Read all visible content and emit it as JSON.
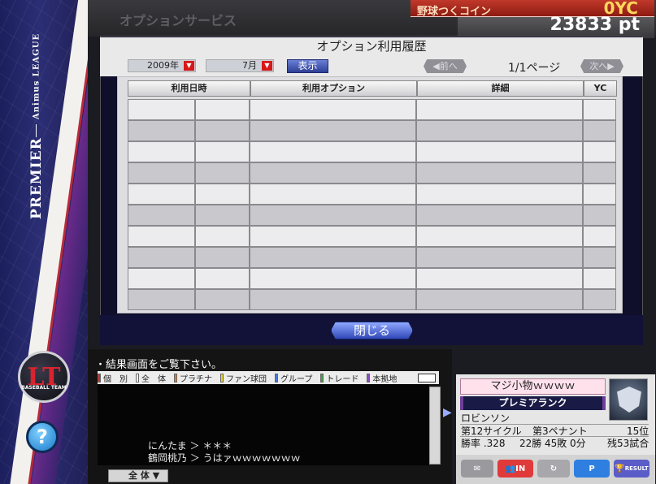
{
  "top": {
    "service_title": "オプションサービス",
    "coin_label": "野球つくコイン",
    "coin_value": "0YC",
    "points": "23833 pt"
  },
  "sidebar": {
    "league": "PREMIER",
    "league_sub": "Animus LEAGUE",
    "team_logo_text": "LT",
    "team_logo_sub": "BASEBALL TEAM",
    "help_icon": "question-icon"
  },
  "panel": {
    "title": "オプション利用履歴",
    "year": "2009年",
    "month": "7月",
    "show_button": "表示",
    "prev_button": "前へ",
    "next_button": "次へ",
    "page_indicator": "1/1ページ",
    "columns": [
      "利用日時",
      "利用オプション",
      "詳細",
      "YC"
    ],
    "row_count": 10,
    "close_button": "閉じる"
  },
  "chat": {
    "notice": "・結果画面をご覧下さい。",
    "tabs": [
      {
        "label": "個　別",
        "color": "#d42a2a"
      },
      {
        "label": "全　体",
        "color": "#ffffff"
      },
      {
        "label": "プラチナ",
        "color": "#f07a1c"
      },
      {
        "label": "ファン球団",
        "color": "#e8d023"
      },
      {
        "label": "グループ",
        "color": "#4a7ad8"
      },
      {
        "label": "トレード",
        "color": "#3fa24a"
      },
      {
        "label": "本拠地",
        "color": "#8a4fc4"
      }
    ],
    "lines": [
      {
        "speaker": "にんたま",
        "text": "＊＊＊"
      },
      {
        "speaker": "鶴岡桃乃",
        "text": "うはァｗｗｗｗｗｗｗ"
      }
    ],
    "channel": "全 体"
  },
  "player": {
    "title": "マジ小物ｗｗｗｗ",
    "rank": "プレミアランク",
    "name": "ロビンソン",
    "cycle": "第12サイクル",
    "pennant": "第3ペナント",
    "position": "15位",
    "win_rate": "勝率 .328",
    "wins": "22勝",
    "losses": "45敗",
    "draws": "0分",
    "remaining": "残53試合",
    "buttons": [
      "mail-icon",
      "in-button",
      "refresh-icon",
      "p-button",
      "result-button"
    ],
    "in_label": "IN",
    "p_label": "P",
    "result_label": "RESULT"
  }
}
